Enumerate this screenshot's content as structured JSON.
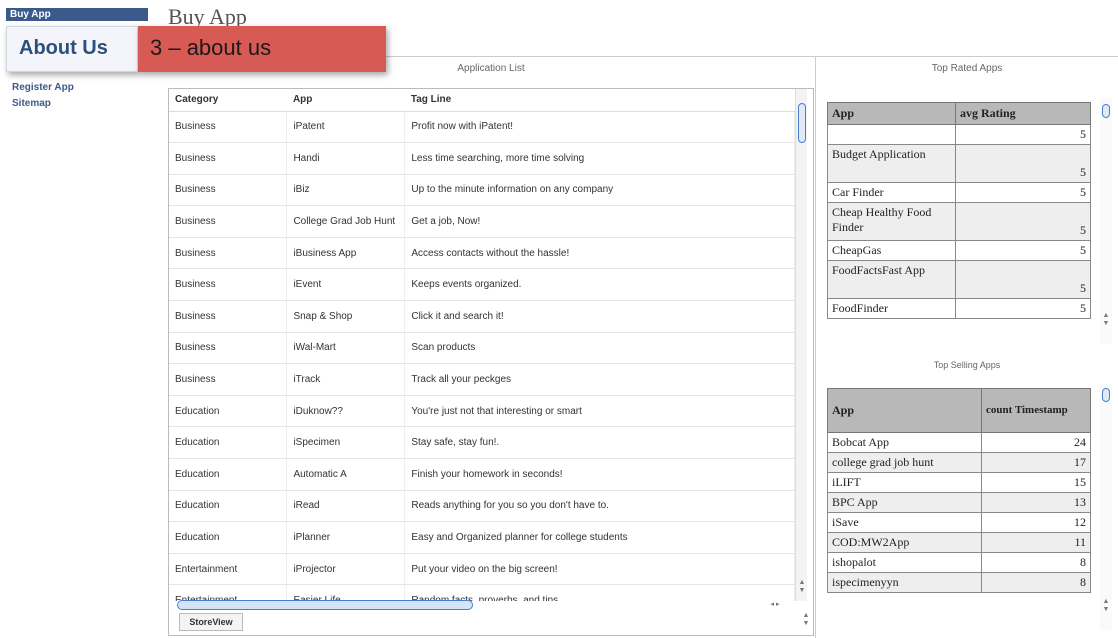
{
  "sidebar": {
    "active_item": "Buy App",
    "items": [
      {
        "label": "Register App"
      },
      {
        "label": "Sitemap"
      }
    ]
  },
  "page_title": "Buy App",
  "tooltip": {
    "label": "About Us",
    "callout": "3 – about us"
  },
  "app_list": {
    "title": "Application List",
    "columns": [
      "Category",
      "App",
      "Tag Line"
    ],
    "rows": [
      [
        "Business",
        "iPatent",
        "Profit now with iPatent!"
      ],
      [
        "Business",
        "Handi",
        "Less time searching, more time solving"
      ],
      [
        "Business",
        "iBiz",
        "Up to the minute information on any company"
      ],
      [
        "Business",
        "College Grad Job Hunt",
        "Get a job, Now!"
      ],
      [
        "Business",
        "iBusiness App",
        "Access contacts without the hassle!"
      ],
      [
        "Business",
        "iEvent",
        "Keeps events organized."
      ],
      [
        "Business",
        "Snap & Shop",
        "Click it and search it!"
      ],
      [
        "Business",
        "iWal-Mart",
        "Scan products"
      ],
      [
        "Business",
        "iTrack",
        "Track all your peckges"
      ],
      [
        "Education",
        "iDuknow??",
        "You're just not that interesting or smart"
      ],
      [
        "Education",
        "iSpecimen",
        "Stay safe, stay fun!."
      ],
      [
        "Education",
        "Automatic A",
        "Finish your homework in seconds!"
      ],
      [
        "Education",
        "iRead",
        "Reads anything for you so you don't have to."
      ],
      [
        "Education",
        "iPlanner",
        "Easy and Organized planner for college students"
      ],
      [
        "Entertainment",
        "iProjector",
        "Put your video on the big screen!"
      ],
      [
        "Entertainment",
        "Easier Life",
        "Random facts, proverbs ,and tips"
      ]
    ],
    "storeview_button": "StoreView"
  },
  "top_rated": {
    "title": "Top Rated Apps",
    "columns": [
      "App",
      "avg Rating"
    ],
    "rows": [
      [
        "",
        "5"
      ],
      [
        "Budget Application",
        "5"
      ],
      [
        "Car Finder",
        "5"
      ],
      [
        "Cheap Healthy Food Finder",
        "5"
      ],
      [
        "CheapGas",
        "5"
      ],
      [
        "FoodFactsFast App",
        "5"
      ],
      [
        "FoodFinder",
        "5"
      ]
    ]
  },
  "top_selling": {
    "title": "Top Selling Apps",
    "columns": [
      "App",
      "count Timestamp"
    ],
    "rows": [
      [
        "Bobcat App",
        "24"
      ],
      [
        "college grad job hunt",
        "17"
      ],
      [
        "iLIFT",
        "15"
      ],
      [
        "BPC App",
        "13"
      ],
      [
        "iSave",
        "12"
      ],
      [
        "COD:MW2App",
        "11"
      ],
      [
        "ishopalot",
        "8"
      ],
      [
        "ispecimenyyn",
        "8"
      ]
    ]
  },
  "colors": {
    "sidebar_active": "#3a5a8c",
    "callout": "#d85a54",
    "scroll_accent": "#4a7fd0"
  }
}
